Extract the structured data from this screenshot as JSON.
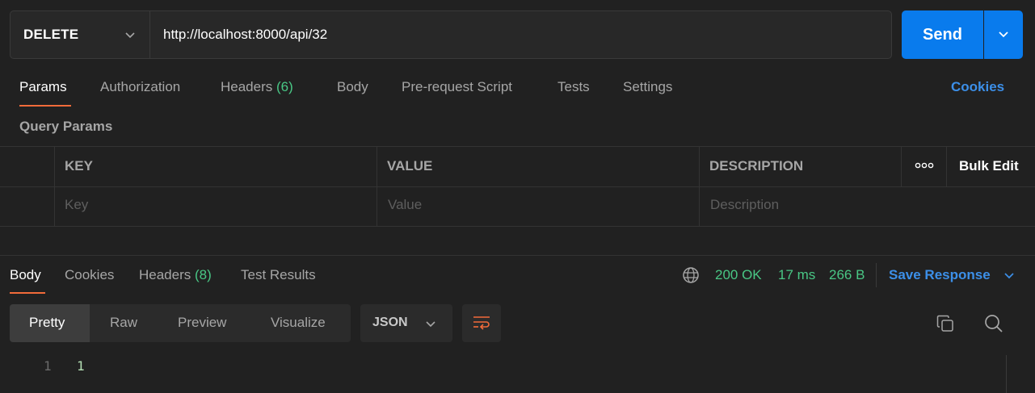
{
  "request": {
    "method": "DELETE",
    "url": "http://localhost:8000/api/32",
    "send_label": "Send"
  },
  "request_tabs": {
    "params": "Params",
    "authorization": "Authorization",
    "headers": "Headers",
    "headers_count": "(6)",
    "body": "Body",
    "pre_request": "Pre-request Script",
    "tests": "Tests",
    "settings": "Settings",
    "cookies": "Cookies"
  },
  "query_params": {
    "title": "Query Params",
    "columns": [
      "KEY",
      "VALUE",
      "DESCRIPTION"
    ],
    "placeholders": {
      "key": "Key",
      "value": "Value",
      "description": "Description"
    },
    "bulk_edit": "Bulk Edit"
  },
  "response_tabs": {
    "body": "Body",
    "cookies": "Cookies",
    "headers": "Headers",
    "headers_count": "(8)",
    "test_results": "Test Results"
  },
  "response_status": {
    "status": "200 OK",
    "time": "17 ms",
    "size": "266 B",
    "save_response": "Save Response"
  },
  "format": {
    "options": [
      "Pretty",
      "Raw",
      "Preview",
      "Visualize"
    ],
    "language": "JSON"
  },
  "response_body": {
    "lines": [
      {
        "number": "1",
        "content": "1"
      }
    ]
  },
  "colors": {
    "accent": "#f26b3a",
    "primary": "#097bed",
    "success": "#49c785",
    "link": "#3c8fe8"
  }
}
